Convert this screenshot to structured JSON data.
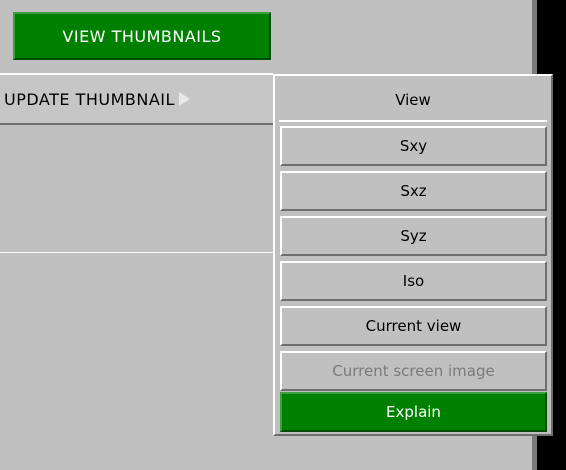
{
  "toolbar": {
    "view_thumbnails": "VIEW THUMBNAILS",
    "update_thumbnail": "UPDATE THUMBNAIL"
  },
  "menu": {
    "title": "View",
    "items": [
      {
        "label": "Sxy",
        "state": "normal"
      },
      {
        "label": "Sxz",
        "state": "normal"
      },
      {
        "label": "Syz",
        "state": "normal"
      },
      {
        "label": "Iso",
        "state": "normal"
      },
      {
        "label": "Current view",
        "state": "normal"
      },
      {
        "label": "Current screen image",
        "state": "disabled"
      },
      {
        "label": "Explain",
        "state": "highlighted"
      }
    ]
  },
  "colors": {
    "accent_green": "#008000",
    "panel_grey": "#c0c0c0",
    "disabled_text": "#7a7a7a"
  },
  "icons": {
    "submenu_arrow": "triangle-right-icon"
  }
}
